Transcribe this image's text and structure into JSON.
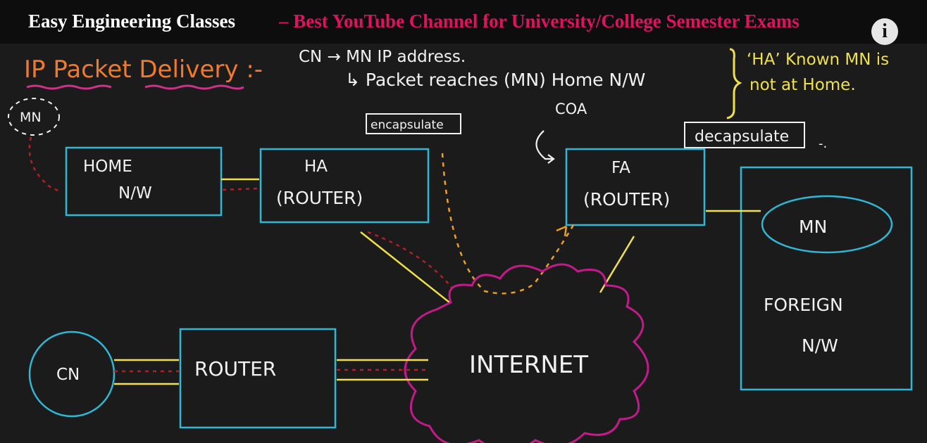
{
  "header": {
    "title": "Easy Engineering Classes",
    "subtitle": "– Best YouTube Channel for University/College Semester Exams",
    "info_icon": "i"
  },
  "notes": {
    "heading": "IP Packet Delivery :-",
    "line1": "CN → MN IP address.",
    "line2": "↳ Packet reaches (MN) Home N/W",
    "brace_note_1": "‘HA’ Known MN is",
    "brace_note_2": "not at Home."
  },
  "diagram": {
    "mn_small": "MN",
    "home_nw_line1": "HOME",
    "home_nw_line2": "N/W",
    "ha_line1": "HA",
    "ha_line2": "(ROUTER)",
    "fa_line1": "FA",
    "fa_line2": "(ROUTER)",
    "encapsulate": "encapsulate",
    "decapsulate": "decapsulate",
    "coa": "COA",
    "mn": "MN",
    "foreign_line1": "FOREIGN",
    "foreign_line2": "N/W",
    "cn": "CN",
    "router": "ROUTER",
    "internet": "INTERNET"
  },
  "colors": {
    "cyan": "#2fb8d6",
    "yellow": "#f0e14a",
    "magenta": "#c21a8a",
    "orange": "#f07a2a",
    "red_dash": "#b41e28",
    "pink_underline": "#d0308a"
  }
}
